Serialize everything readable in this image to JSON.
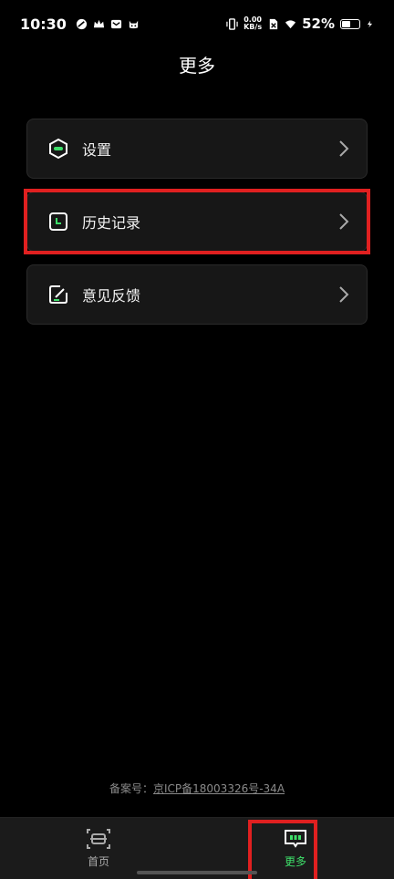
{
  "status_bar": {
    "time": "10:30",
    "net_speed_value": "0.00",
    "net_speed_unit": "KB/s",
    "battery": "52%",
    "battery_level": 0.52
  },
  "header": {
    "title": "更多"
  },
  "menu": {
    "items": [
      {
        "label": "设置",
        "icon": "settings-hexagon-icon"
      },
      {
        "label": "历史记录",
        "icon": "clock-icon"
      },
      {
        "label": "意见反馈",
        "icon": "feedback-edit-icon"
      }
    ]
  },
  "footer": {
    "icp_prefix": "备案号：",
    "icp_link": "京ICP备18003326号-34A"
  },
  "tabs": [
    {
      "label": "首页",
      "icon": "scan-frame-icon"
    },
    {
      "label": "更多",
      "icon": "chat-dots-icon"
    }
  ],
  "colors": {
    "accent_green": "#3ee06a",
    "highlight_red": "#e02020",
    "card_bg": "#171717"
  }
}
